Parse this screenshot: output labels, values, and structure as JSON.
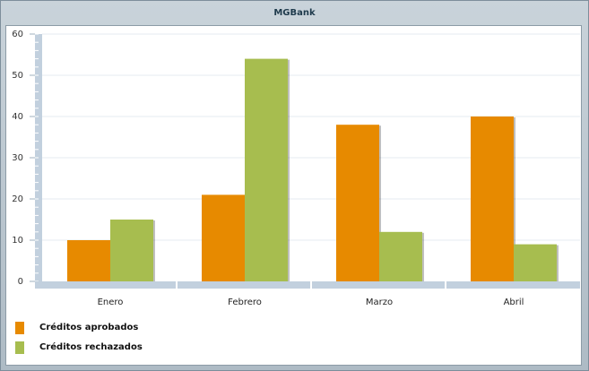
{
  "window": {
    "title": "MGBank"
  },
  "colors": {
    "series_1": "#e78a00",
    "series_2": "#a7bd4f",
    "axis": "#c2d0de",
    "grid": "#e6ebf0"
  },
  "chart_data": {
    "type": "bar",
    "title": "MGBank",
    "categories": [
      "Enero",
      "Febrero",
      "Marzo",
      "Abril"
    ],
    "series": [
      {
        "name": "Créditos aprobados",
        "values": [
          10,
          21,
          38,
          40
        ]
      },
      {
        "name": "Créditos rechazados",
        "values": [
          15,
          54,
          12,
          9
        ]
      }
    ],
    "ylim": [
      0,
      60
    ],
    "yticks": [
      0,
      10,
      20,
      30,
      40,
      50,
      60
    ],
    "xlabel": "",
    "ylabel": "",
    "grid": true,
    "legend_position": "bottom-left"
  }
}
